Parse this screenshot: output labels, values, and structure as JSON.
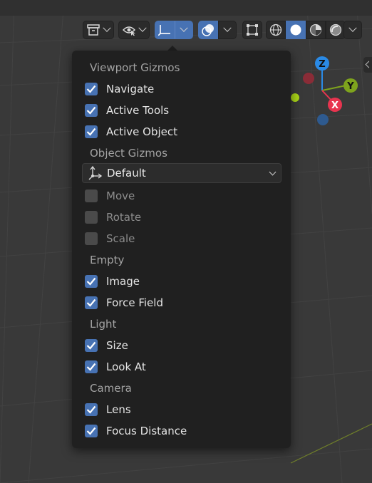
{
  "colors": {
    "accent": "#4772b3",
    "popup_bg": "#202020",
    "viewport_bg": "#393939",
    "axis_x": "#e8344f",
    "axis_y": "#7ea31d",
    "axis_z": "#2a8ae6"
  },
  "header": {
    "buttons": [
      {
        "icon": "object-type-visibility-icon"
      },
      {
        "icon": "selectability-visibility-icon"
      },
      {
        "icon": "gizmo-toggle-icon"
      },
      {
        "icon": "overlays-toggle-icon"
      },
      {
        "icon": "xray-toggle-icon"
      },
      {
        "icon": "wireframe-shading-icon"
      },
      {
        "icon": "solid-shading-icon"
      },
      {
        "icon": "material-preview-shading-icon"
      },
      {
        "icon": "rendered-shading-icon"
      }
    ]
  },
  "navigation_gizmo": {
    "axes": [
      "X",
      "Y",
      "Z"
    ]
  },
  "popup": {
    "viewport_gizmos": {
      "title": "Viewport Gizmos",
      "items": [
        {
          "label": "Navigate",
          "checked": true
        },
        {
          "label": "Active Tools",
          "checked": true
        },
        {
          "label": "Active Object",
          "checked": true
        }
      ]
    },
    "object_gizmos": {
      "title": "Object Gizmos",
      "orientation": {
        "selected": "Default"
      },
      "items": [
        {
          "label": "Move",
          "checked": false
        },
        {
          "label": "Rotate",
          "checked": false
        },
        {
          "label": "Scale",
          "checked": false
        }
      ]
    },
    "empty": {
      "title": "Empty",
      "items": [
        {
          "label": "Image",
          "checked": true
        },
        {
          "label": "Force Field",
          "checked": true
        }
      ]
    },
    "light": {
      "title": "Light",
      "items": [
        {
          "label": "Size",
          "checked": true
        },
        {
          "label": "Look At",
          "checked": true
        }
      ]
    },
    "camera": {
      "title": "Camera",
      "items": [
        {
          "label": "Lens",
          "checked": true
        },
        {
          "label": "Focus Distance",
          "checked": true
        }
      ]
    }
  }
}
